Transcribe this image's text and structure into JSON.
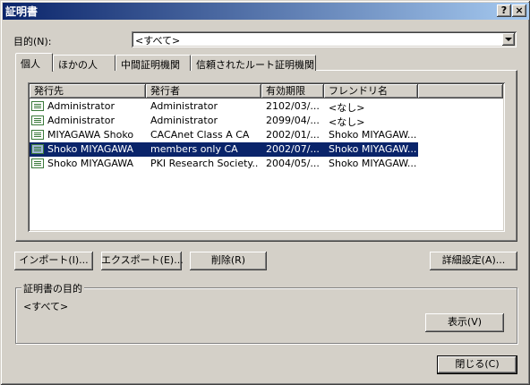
{
  "window": {
    "title": "証明書",
    "help_glyph": "?",
    "close_glyph": "×"
  },
  "purpose": {
    "label": "目的(N):",
    "value": "<すべて>"
  },
  "tabs": [
    {
      "label": "個人"
    },
    {
      "label": "ほかの人"
    },
    {
      "label": "中間証明機関"
    },
    {
      "label": "信頼されたルート証明機関"
    }
  ],
  "list": {
    "columns": [
      "発行先",
      "発行者",
      "有効期限",
      "フレンドリ名"
    ],
    "rows": [
      {
        "issued_to": "Administrator",
        "issued_by": "Administrator",
        "expires": "2102/03/...",
        "friendly": "<なし>"
      },
      {
        "issued_to": "Administrator",
        "issued_by": "Administrator",
        "expires": "2099/04/...",
        "friendly": "<なし>"
      },
      {
        "issued_to": "MIYAGAWA Shoko",
        "issued_by": "CACAnet Class A CA",
        "expires": "2002/01/...",
        "friendly": "Shoko MIYAGAW..."
      },
      {
        "issued_to": "Shoko MIYAGAWA",
        "issued_by": "members only CA",
        "expires": "2002/07/...",
        "friendly": "Shoko MIYAGAW..."
      },
      {
        "issued_to": "Shoko MIYAGAWA",
        "issued_by": "PKI Research Society...",
        "expires": "2004/05/...",
        "friendly": "Shoko MIYAGAW..."
      }
    ]
  },
  "buttons": {
    "import": "インポート(I)...",
    "export": "エクスポート(E)...",
    "remove": "削除(R)",
    "advanced": "詳細設定(A)...",
    "view": "表示(V)",
    "close": "閉じる(C)"
  },
  "purposes_group": {
    "legend": "証明書の目的",
    "value": "<すべて>"
  }
}
